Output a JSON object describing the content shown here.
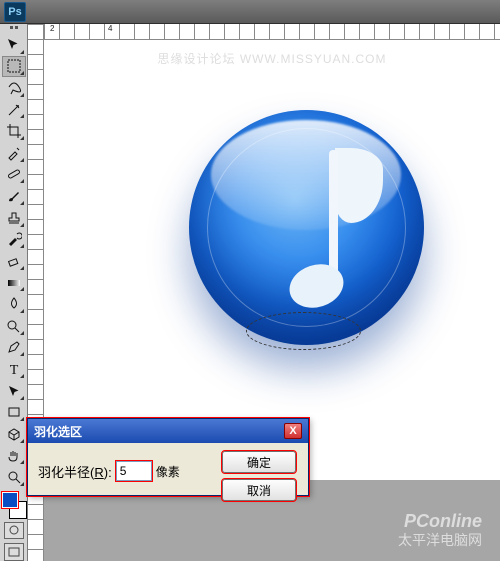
{
  "app": {
    "logo": "Ps",
    "watermark_top": "思缘设计论坛    WWW.MISSYUAN.COM",
    "watermark_footer_line1": "PConline",
    "watermark_footer_line2": "太平洋电脑网"
  },
  "ruler": {
    "h_marks": [
      "2",
      "4"
    ],
    "v_marks": []
  },
  "tools": [
    {
      "name": "move-tool",
      "glyph": "move"
    },
    {
      "name": "marquee-tool",
      "glyph": "marquee",
      "selected": true
    },
    {
      "name": "lasso-tool",
      "glyph": "lasso"
    },
    {
      "name": "magic-wand-tool",
      "glyph": "wand"
    },
    {
      "name": "crop-tool",
      "glyph": "crop"
    },
    {
      "name": "eyedropper-tool",
      "glyph": "eyedropper"
    },
    {
      "name": "healing-brush-tool",
      "glyph": "bandaid"
    },
    {
      "name": "brush-tool",
      "glyph": "brush"
    },
    {
      "name": "stamp-tool",
      "glyph": "stamp"
    },
    {
      "name": "history-brush-tool",
      "glyph": "history"
    },
    {
      "name": "eraser-tool",
      "glyph": "eraser"
    },
    {
      "name": "gradient-tool",
      "glyph": "gradient"
    },
    {
      "name": "blur-tool",
      "glyph": "blur"
    },
    {
      "name": "dodge-tool",
      "glyph": "dodge"
    },
    {
      "name": "pen-tool",
      "glyph": "pen"
    },
    {
      "name": "type-tool",
      "glyph": "T"
    },
    {
      "name": "path-select-tool",
      "glyph": "arrow"
    },
    {
      "name": "rectangle-tool",
      "glyph": "rect"
    },
    {
      "name": "3d-tool",
      "glyph": "cube"
    },
    {
      "name": "hand-tool",
      "glyph": "hand"
    },
    {
      "name": "zoom-tool",
      "glyph": "zoom"
    }
  ],
  "colors": {
    "foreground": "#0b4ec4",
    "background": "#ffffff"
  },
  "dialog": {
    "title": "羽化选区",
    "radius_label_prefix": "羽化半径(",
    "radius_hotkey": "R",
    "radius_label_suffix": "):",
    "radius_value": "5",
    "unit": "像素",
    "ok": "确定",
    "cancel": "取消",
    "close": "X"
  }
}
